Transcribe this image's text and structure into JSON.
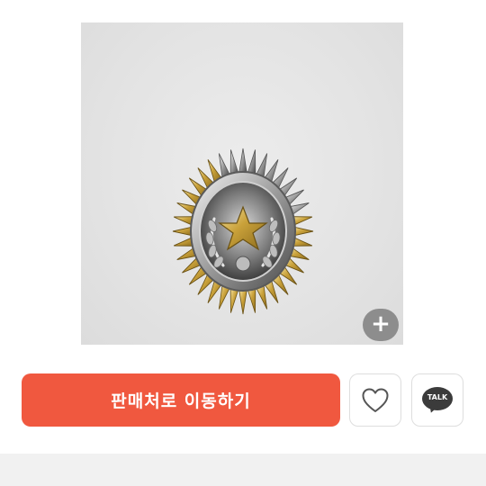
{
  "product": {
    "image_alt_icon": "military-badge-photo",
    "zoom_label": "+",
    "zoom_icon": "plus-icon"
  },
  "actions": {
    "cta_label": "판매처로 이동하기",
    "like_icon": "heart-icon",
    "talk_label": "TALK",
    "talk_icon": "kakao-talk-icon"
  },
  "colors": {
    "cta": "#f0583f",
    "photo_background": "#e4e4e4",
    "divider": "#f1f1f1"
  }
}
